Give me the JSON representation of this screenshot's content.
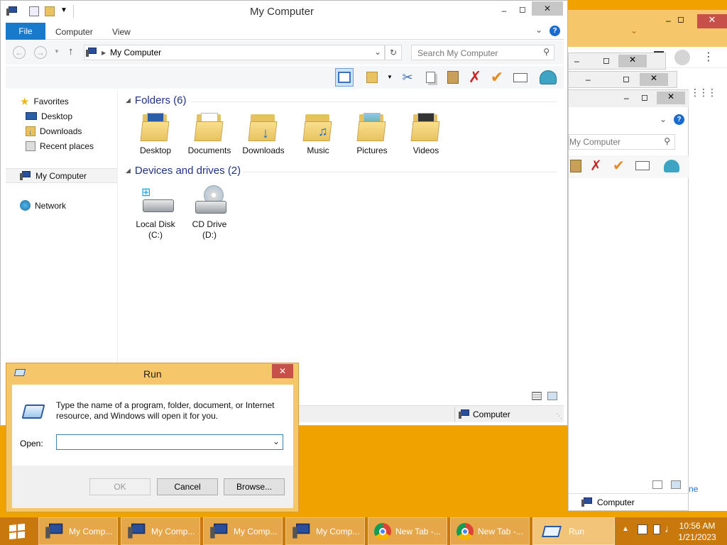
{
  "explorer": {
    "title": "My Computer",
    "ribbon_tabs": [
      "File",
      "Computer",
      "View"
    ],
    "address": "My Computer",
    "search_placeholder": "Search My Computer",
    "nav": {
      "favorites": "Favorites",
      "desktop": "Desktop",
      "downloads": "Downloads",
      "recent": "Recent places",
      "my_computer": "My Computer",
      "network": "Network"
    },
    "folders_header": "Folders (6)",
    "folders": [
      "Desktop",
      "Documents",
      "Downloads",
      "Music",
      "Pictures",
      "Videos"
    ],
    "devices_header": "Devices and drives (2)",
    "drives": [
      {
        "line1": "Local Disk",
        "line2": "(C:)"
      },
      {
        "line1": "CD Drive",
        "line2": "(D:)"
      }
    ],
    "status_computer": "Computer"
  },
  "back_window": {
    "search_placeholder": "My Computer",
    "status_computer": "Computer",
    "partial_text": "ne"
  },
  "run": {
    "title": "Run",
    "description": "Type the name of a program, folder, document, or Internet resource, and Windows will open it for you.",
    "open_label": "Open:",
    "open_value": "",
    "ok": "OK",
    "cancel": "Cancel",
    "browse": "Browse..."
  },
  "taskbar": {
    "items": [
      {
        "label": "My Comp...",
        "icon": "computer-icon"
      },
      {
        "label": "My Comp...",
        "icon": "computer-icon"
      },
      {
        "label": "My Comp...",
        "icon": "computer-icon"
      },
      {
        "label": "My Comp...",
        "icon": "computer-icon"
      },
      {
        "label": "New Tab -...",
        "icon": "chrome-icon"
      },
      {
        "label": "New Tab -...",
        "icon": "chrome-icon"
      },
      {
        "label": "Run",
        "icon": "run-icon"
      }
    ],
    "time": "10:56 AM",
    "date": "1/21/2023"
  },
  "colors": {
    "desktop": "#f0a300",
    "taskbar": "#c9780b",
    "file_tab": "#1979ca",
    "group_header": "#1e3287",
    "run_frame": "#f5c76a"
  }
}
